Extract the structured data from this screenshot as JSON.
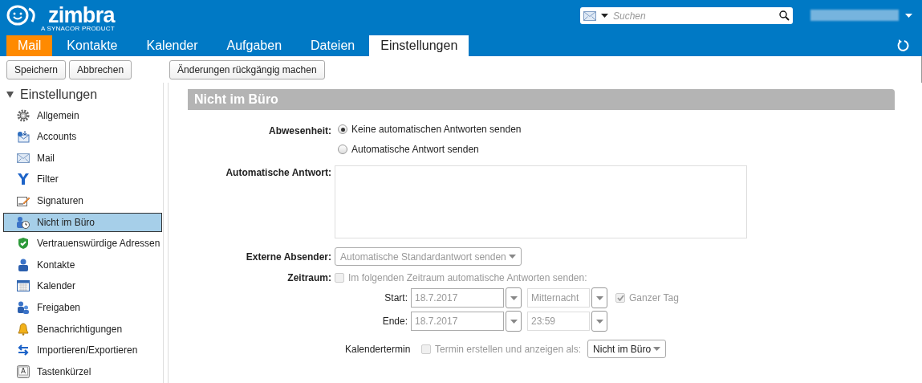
{
  "header": {
    "logo": "zimbra",
    "logo_tagline": "A SYNACOR PRODUCT",
    "search": {
      "placeholder": "Suchen"
    }
  },
  "tabs": [
    {
      "label": "Mail",
      "selected": false,
      "highlighted": true
    },
    {
      "label": "Kontakte",
      "selected": false,
      "highlighted": false
    },
    {
      "label": "Kalender",
      "selected": false,
      "highlighted": false
    },
    {
      "label": "Aufgaben",
      "selected": false,
      "highlighted": false
    },
    {
      "label": "Dateien",
      "selected": false,
      "highlighted": false
    },
    {
      "label": "Einstellungen",
      "selected": true,
      "highlighted": false
    }
  ],
  "toolbar": {
    "buttons": [
      "Speichern",
      "Abbrechen",
      "Änderungen rückgängig machen"
    ]
  },
  "sidebar": {
    "title": "Einstellungen",
    "expanded": true,
    "items": [
      {
        "label": "Allgemein",
        "selected": false
      },
      {
        "label": "Accounts",
        "selected": false
      },
      {
        "label": "Mail",
        "selected": false
      },
      {
        "label": "Filter",
        "selected": false
      },
      {
        "label": "Signaturen",
        "selected": false
      },
      {
        "label": "Nicht im Büro",
        "selected": true
      },
      {
        "label": "Vertrauenswürdige Adressen",
        "selected": false
      },
      {
        "label": "Kontakte",
        "selected": false
      },
      {
        "label": "Kalender",
        "selected": false
      },
      {
        "label": "Freigaben",
        "selected": false
      },
      {
        "label": "Benachrichtigungen",
        "selected": false
      },
      {
        "label": "Importieren/Exportieren",
        "selected": false
      },
      {
        "label": "Tastenkürzel",
        "selected": false
      }
    ]
  },
  "panel": {
    "title": "Nicht im Büro",
    "absence": {
      "label": "Abwesenheit:",
      "options": [
        {
          "label": "Keine automatischen Antworten senden",
          "selected": true
        },
        {
          "label": "Automatische Antwort senden",
          "selected": false
        }
      ]
    },
    "auto_reply": {
      "label": "Automatische Antwort:"
    },
    "external_senders": {
      "label": "Externe Absender:",
      "value": "Automatische Standardantwort senden",
      "disabled": true
    },
    "period": {
      "label": "Zeitraum:",
      "checkbox": {
        "label": "Im folgenden Zeitraum automatische Antworten senden:",
        "checked": false,
        "disabled": true
      },
      "start": {
        "label": "Start:",
        "date": "18.7.2017",
        "time": "Mitternacht"
      },
      "end": {
        "label": "Ende:",
        "date": "18.7.2017",
        "time": "23:59"
      },
      "all_day": {
        "label": "Ganzer Tag",
        "checked": true,
        "disabled": true
      }
    },
    "calendar_event": {
      "label": "Kalendertermin",
      "checkbox": {
        "label": "Termin erstellen und anzeigen als:",
        "checked": false,
        "disabled": true
      },
      "value": "Nicht im Büro"
    }
  }
}
